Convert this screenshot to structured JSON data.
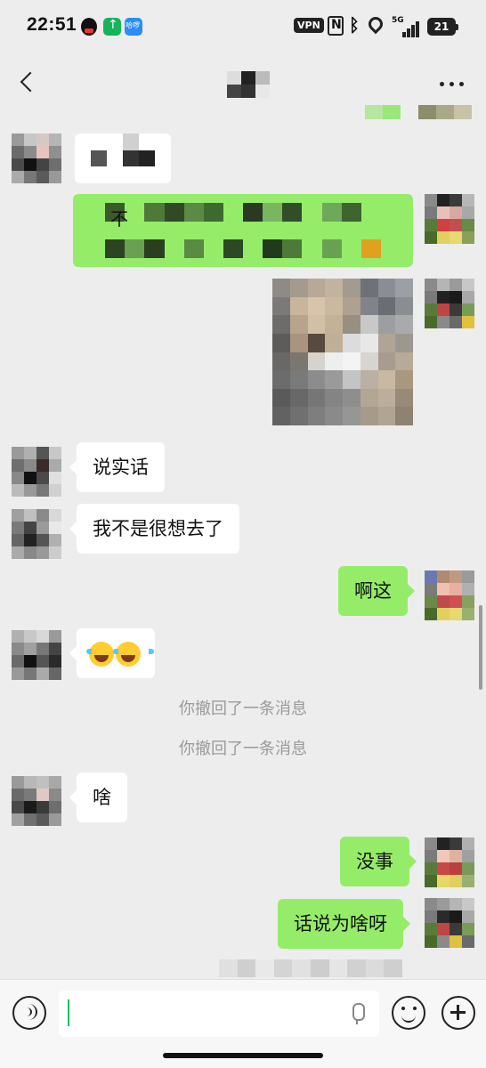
{
  "status_bar": {
    "time": "22:51",
    "vpn": "VPN",
    "network": "5G",
    "battery": "21",
    "icons": [
      "qq-icon",
      "upload-app-icon",
      "hellobike-app-icon",
      "nfc-icon",
      "bluetooth-icon",
      "location-icon",
      "signal-icon",
      "battery-icon"
    ]
  },
  "header": {
    "back_icon": "chevron-left-icon",
    "more_icon": "more-dots-icon"
  },
  "messages": [
    {
      "side": "left",
      "type": "blurred"
    },
    {
      "side": "right",
      "type": "blurred",
      "visible_text": "不"
    },
    {
      "side": "right",
      "type": "image"
    },
    {
      "side": "left",
      "type": "text",
      "text": "说实话"
    },
    {
      "side": "left",
      "type": "text",
      "text": "我不是很想去了"
    },
    {
      "side": "right",
      "type": "text",
      "text": "啊这"
    },
    {
      "side": "left",
      "type": "emoji",
      "emoji": [
        "face-with-tears-of-joy-icon",
        "face-with-tears-of-joy-icon"
      ]
    },
    {
      "side": "system",
      "type": "system",
      "text": "你撤回了一条消息"
    },
    {
      "side": "system",
      "type": "system",
      "text": "你撤回了一条消息"
    },
    {
      "side": "left",
      "type": "text",
      "text": "啥"
    },
    {
      "side": "right",
      "type": "text",
      "text": "没事"
    },
    {
      "side": "right",
      "type": "text",
      "text": "话说为啥呀"
    }
  ],
  "input_bar": {
    "value": "",
    "icons": [
      "voice-icon",
      "microphone-icon",
      "emoji-icon",
      "plus-icon"
    ]
  },
  "colors": {
    "background": "#ededed",
    "bubble_mine": "#95ec69",
    "bubble_other": "#ffffff",
    "system_text": "#9a9a9a",
    "caret": "#07c160"
  }
}
